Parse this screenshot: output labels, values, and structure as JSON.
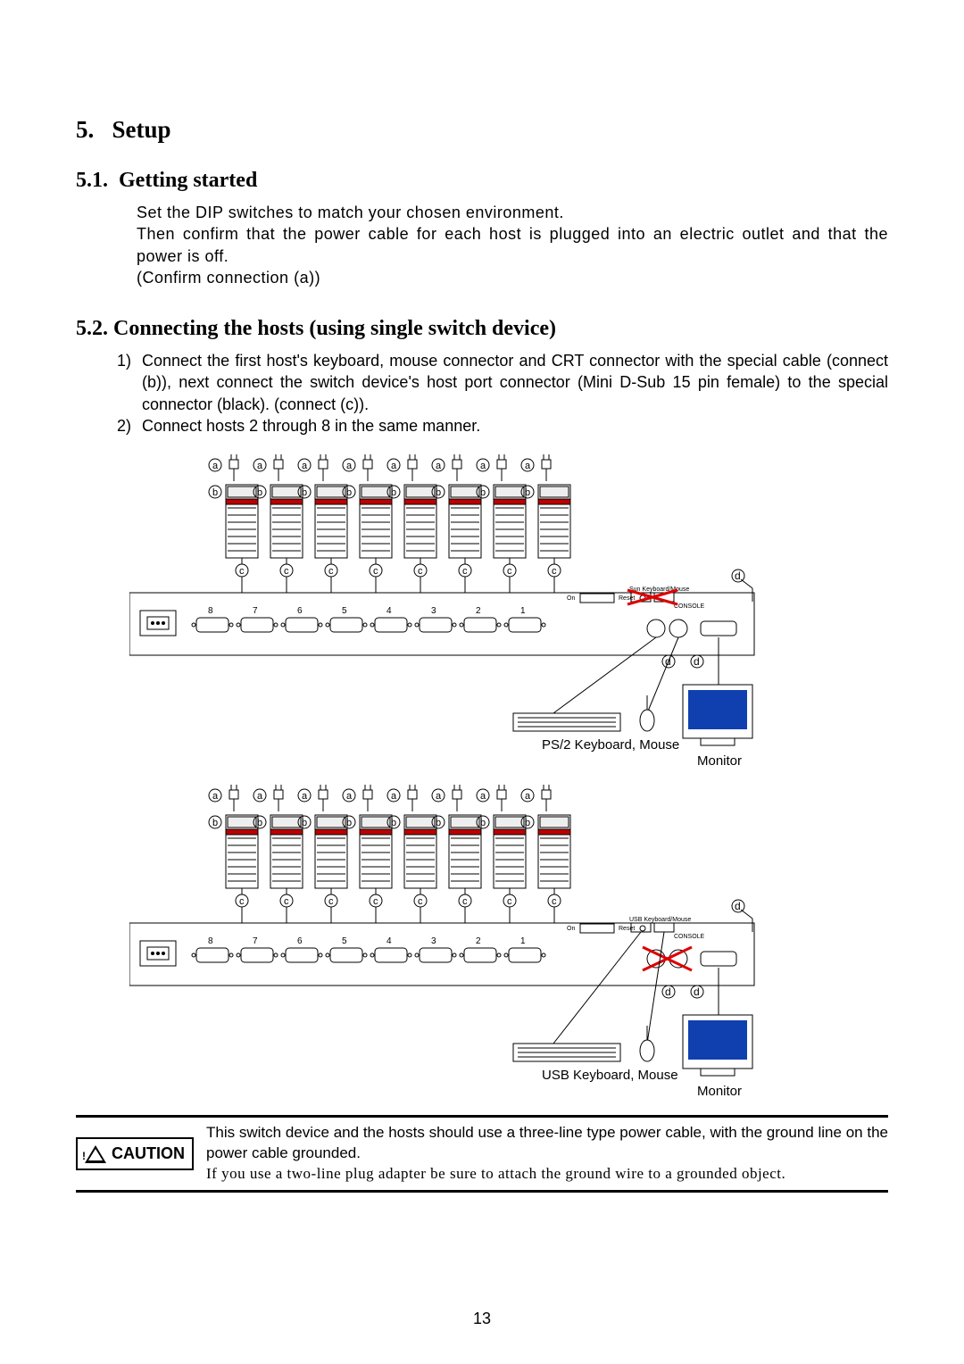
{
  "sections": {
    "setup": {
      "number": "5.",
      "title": "Setup"
    },
    "getting_started": {
      "number": "5.1.",
      "title": "Getting started",
      "body": "Set the DIP switches to match your chosen environment.\nThen confirm that the power cable for each host is plugged into an electric outlet and that the power is off.\n(Confirm connection (a))"
    },
    "connecting": {
      "number": "5.2.",
      "title": "Connecting the hosts (using single switch device)",
      "items": [
        {
          "marker": "1)",
          "text": "Connect the first host's keyboard, mouse connector and CRT connector with the special cable (connect (b)), next connect the switch device's host port connector (Mini D-Sub 15 pin female) to the special connector (black). (connect (c))."
        },
        {
          "marker": "2)",
          "text": "Connect hosts 2 through 8 in the same manner."
        }
      ]
    }
  },
  "diagram1": {
    "host_labels_a": [
      "a",
      "a",
      "a",
      "a",
      "a",
      "a",
      "a",
      "a"
    ],
    "host_labels_b": [
      "b",
      "b",
      "b",
      "b",
      "b",
      "b",
      "b",
      "b"
    ],
    "host_labels_c": [
      "c",
      "c",
      "c",
      "c",
      "c",
      "c",
      "c",
      "c"
    ],
    "port_numbers": [
      "8",
      "7",
      "6",
      "5",
      "4",
      "3",
      "2",
      "1"
    ],
    "back_panel_top": [
      "On",
      "Reset",
      "Sun Keyboard/Mouse",
      "CONSOLE"
    ],
    "console_labels": {
      "d": "d",
      "kbd_mouse": "PS/2 Keyboard, Mouse",
      "monitor": "Monitor"
    }
  },
  "diagram2": {
    "host_labels_a": [
      "a",
      "a",
      "a",
      "a",
      "a",
      "a",
      "a",
      "a"
    ],
    "host_labels_b": [
      "b",
      "b",
      "b",
      "b",
      "b",
      "b",
      "b",
      "b"
    ],
    "host_labels_c": [
      "c",
      "c",
      "c",
      "c",
      "c",
      "c",
      "c",
      "c"
    ],
    "port_numbers": [
      "8",
      "7",
      "6",
      "5",
      "4",
      "3",
      "2",
      "1"
    ],
    "back_panel_top": [
      "On",
      "Reset",
      "USB Keyboard/Mouse",
      "CONSOLE"
    ],
    "console_labels": {
      "d": "d",
      "kbd_mouse": "USB Keyboard, Mouse",
      "monitor": "Monitor"
    }
  },
  "caution": {
    "label": "CAUTION",
    "line1": "This switch device and the hosts should use a three-line type power cable, with the ground line on the power cable grounded.",
    "line2": "If you use a two-line plug adapter be sure to attach the ground wire to a grounded object."
  },
  "page_number": "13"
}
